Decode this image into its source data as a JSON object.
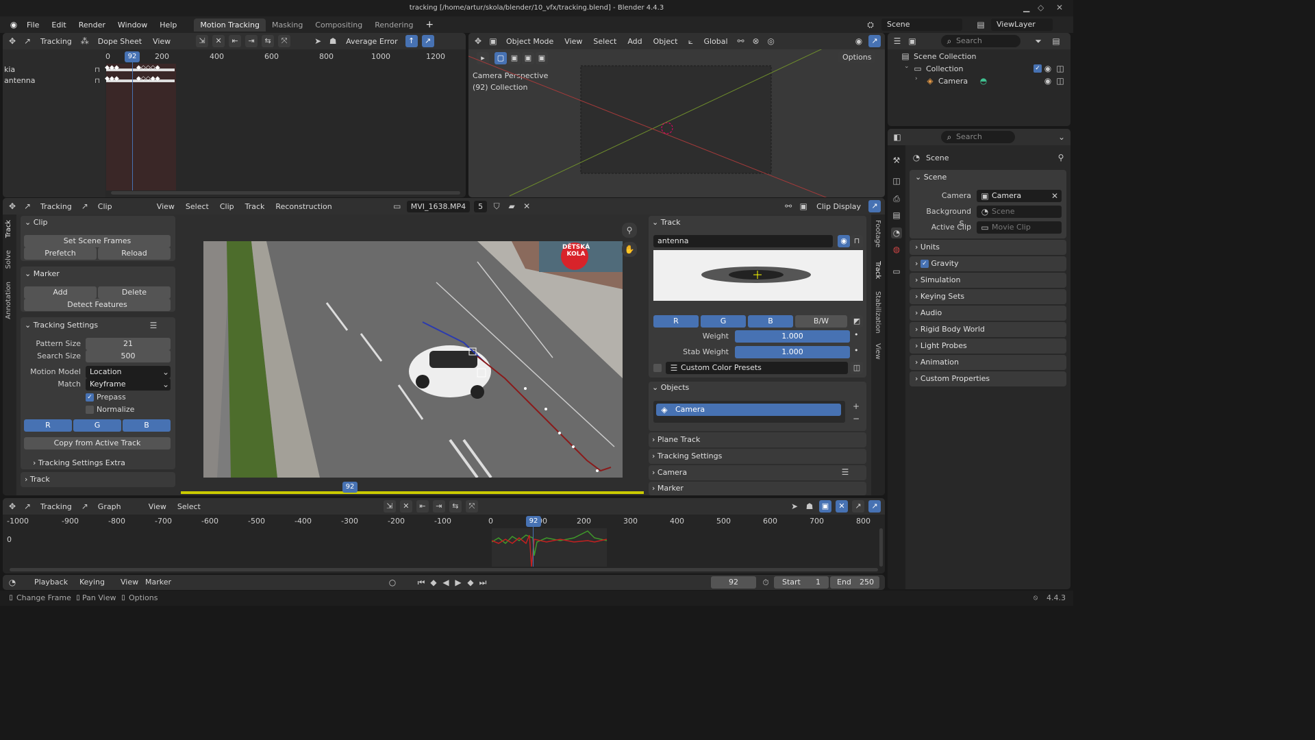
{
  "window": {
    "title": "tracking [/home/artur/skola/blender/10_vfx/tracking.blend] - Blender 4.4.3"
  },
  "menu": [
    "File",
    "Edit",
    "Render",
    "Window",
    "Help"
  ],
  "workspaces": [
    "Motion Tracking",
    "Masking",
    "Compositing",
    "Rendering"
  ],
  "scene_selector": {
    "scene": "Scene",
    "view_layer": "ViewLayer"
  },
  "dopesheet": {
    "mode": "Tracking",
    "view_type": "Dope Sheet",
    "view": "View",
    "sort": "Average Error",
    "current_frame": "92",
    "ticks": [
      "0",
      "200",
      "400",
      "600",
      "800",
      "1000",
      "1200"
    ],
    "channels": [
      "kia",
      "antenna"
    ]
  },
  "viewport": {
    "mode": "Object Mode",
    "menus": [
      "View",
      "Select",
      "Add",
      "Object"
    ],
    "orientation": "Global",
    "options": "Options",
    "overlay_line1": "Camera Perspective",
    "overlay_line2": "(92) Collection"
  },
  "outliner": {
    "search_placeholder": "Search",
    "scene_collection": "Scene Collection",
    "collection": "Collection",
    "camera": "Camera"
  },
  "properties": {
    "search_placeholder": "Search",
    "breadcrumb": "Scene",
    "scene_panel": "Scene",
    "camera_label": "Camera",
    "camera_value": "Camera",
    "bg_label": "Background S...",
    "bg_value": "Scene",
    "clip_label": "Active Clip",
    "clip_value": "Movie Clip",
    "sections": [
      "Units",
      "Gravity",
      "Simulation",
      "Keying Sets",
      "Audio",
      "Rigid Body World",
      "Light Probes",
      "Animation",
      "Custom Properties"
    ]
  },
  "clip_editor": {
    "mode": "Tracking",
    "view_type": "Clip",
    "menus": [
      "View",
      "Select",
      "Clip",
      "Track",
      "Reconstruction"
    ],
    "clip_name": "MVI_1638.MP4",
    "clip_users": "5",
    "display": "Clip Display",
    "current_frame": "92",
    "vtabs_left": [
      "Track",
      "Solve",
      "Annotation"
    ],
    "vtabs_right": [
      "Footage",
      "Track",
      "Stabilization",
      "View"
    ],
    "sign_text": "DĚTSKÁ KOLA"
  },
  "toolbox": {
    "clip_panel": "Clip",
    "set_scene_frames": "Set Scene Frames",
    "prefetch": "Prefetch",
    "reload": "Reload",
    "marker_panel": "Marker",
    "add": "Add",
    "delete": "Delete",
    "detect_features": "Detect Features",
    "tracking_settings": "Tracking Settings",
    "pattern_size_label": "Pattern Size",
    "pattern_size": "21",
    "search_size_label": "Search Size",
    "search_size": "500",
    "motion_model_label": "Motion Model",
    "motion_model": "Location",
    "match_label": "Match",
    "match": "Keyframe",
    "prepass": "Prepass",
    "normalize": "Normalize",
    "r": "R",
    "g": "G",
    "b": "B",
    "copy_from_active": "Copy from Active Track",
    "tracking_settings_extra": "Tracking Settings Extra",
    "track_panel": "Track"
  },
  "track_panel": {
    "title": "Track",
    "track_name": "antenna",
    "r": "R",
    "g": "G",
    "b": "B",
    "bw": "B/W",
    "weight_label": "Weight",
    "weight": "1.000",
    "stab_weight_label": "Stab Weight",
    "stab_weight": "1.000",
    "custom_color": "Custom Color Presets",
    "objects_title": "Objects",
    "object_camera": "Camera",
    "collapsed": [
      "Plane Track",
      "Tracking Settings",
      "Camera",
      "Marker"
    ]
  },
  "graph": {
    "mode": "Tracking",
    "view_type": "Graph",
    "menus": [
      "View",
      "Select"
    ],
    "current_frame": "92",
    "ticks": [
      "-1000",
      "-900",
      "-800",
      "-700",
      "-600",
      "-500",
      "-400",
      "-300",
      "-200",
      "-100",
      "0",
      "100",
      "200",
      "300",
      "400",
      "500",
      "600",
      "700",
      "800"
    ],
    "y_zero": "0"
  },
  "timeline": {
    "playback": "Playback",
    "keying": "Keying",
    "view": "View",
    "marker": "Marker",
    "frame": "92",
    "start_label": "Start",
    "start": "1",
    "end_label": "End",
    "end": "250"
  },
  "statusbar": {
    "change_frame": "Change Frame",
    "pan_view": "Pan View",
    "options": "Options",
    "version": "4.4.3"
  }
}
